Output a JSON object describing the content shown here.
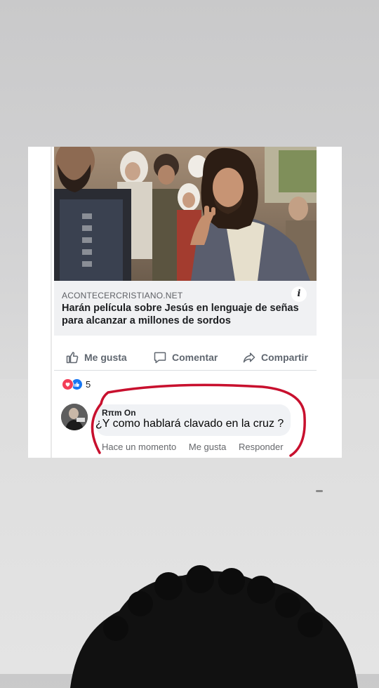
{
  "post": {
    "link": {
      "domain": "ACONTECERCRISTIANO.NET",
      "headline": "Harán película sobre Jesús en lenguaje de señas para alcanzar a millones de sordos",
      "info_icon": "i"
    },
    "actions": {
      "like": "Me gusta",
      "comment": "Comentar",
      "share": "Compartir"
    },
    "reactions": {
      "icons": [
        "love-icon",
        "like-icon"
      ],
      "count": "5"
    },
    "comment": {
      "author": "Rπm On",
      "text": "¿Y como hablará clavado en la cruz ?",
      "time": "Hace un momento",
      "like": "Me gusta",
      "reply": "Responder"
    }
  },
  "colors": {
    "link_bg": "#f0f1f3",
    "action_text": "#606770",
    "bubble_bg": "#f0f2f5",
    "love": "#f33e58",
    "like": "#1877f2",
    "marker_red": "#c8102e"
  }
}
